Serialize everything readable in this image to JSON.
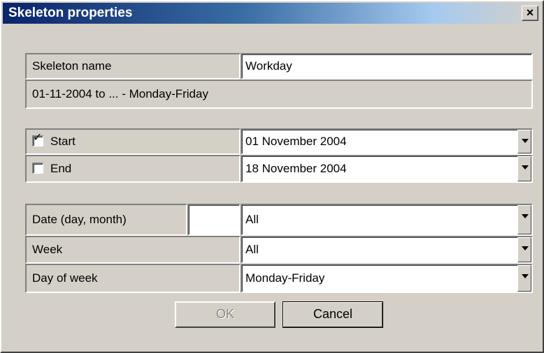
{
  "window": {
    "title": "Skeleton properties",
    "close_label": "×"
  },
  "name_row": {
    "label": "Skeleton name",
    "value": "Workday"
  },
  "summary": "01-11-2004 to ... - Monday-Friday",
  "start": {
    "label": "Start",
    "checked": true,
    "value": "01 November 2004"
  },
  "end": {
    "label": "End",
    "checked": false,
    "value": "18 November 2004"
  },
  "date_row": {
    "label": "Date (day, month)",
    "input_value": "",
    "value": "All"
  },
  "week_row": {
    "label": "Week",
    "value": "All"
  },
  "dow_row": {
    "label": "Day of week",
    "value": "Monday-Friday"
  },
  "buttons": {
    "ok": "OK",
    "cancel": "Cancel"
  },
  "icons": {
    "checkmark": "✓",
    "dropdown": "chevron-down-icon"
  }
}
